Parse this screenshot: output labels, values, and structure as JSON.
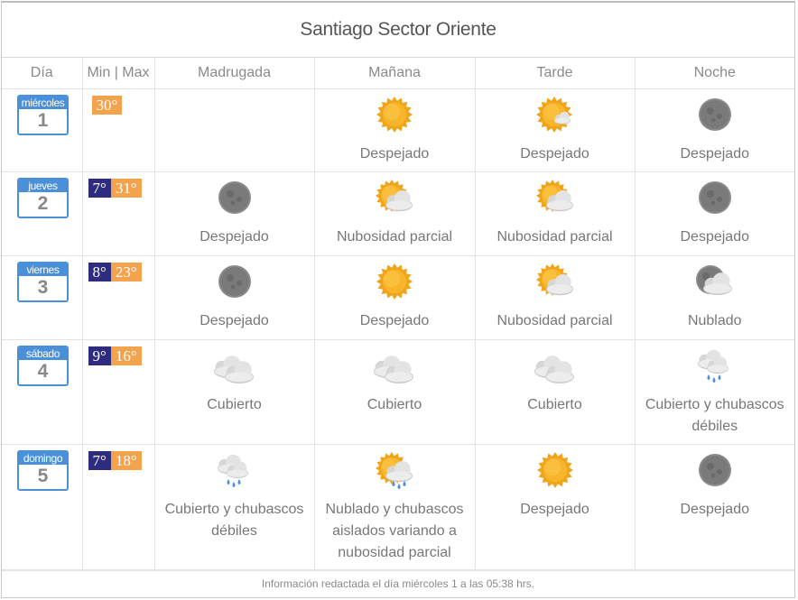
{
  "title": "Santiago Sector Oriente",
  "headers": {
    "dia": "Día",
    "minmax": "Min | Max",
    "madrugada": "Madrugada",
    "manana": "Mañana",
    "tarde": "Tarde",
    "noche": "Noche"
  },
  "colors": {
    "calendar_accent": "#4a90d9",
    "min_badge": "#2e2c7e",
    "max_badge": "#f4a34d"
  },
  "days": [
    {
      "name": "miércoles",
      "num": "1",
      "min": "",
      "max": "30°",
      "madrugada": {
        "icon": "",
        "text": ""
      },
      "manana": {
        "icon": "sun-icon",
        "text": "Despejado"
      },
      "tarde": {
        "icon": "sun-cloud-icon",
        "text": "Despejado"
      },
      "noche": {
        "icon": "moon-icon",
        "text": "Despejado"
      }
    },
    {
      "name": "jueves",
      "num": "2",
      "min": "7°",
      "max": "31°",
      "madrugada": {
        "icon": "moon-icon",
        "text": "Despejado"
      },
      "manana": {
        "icon": "partly-cloudy-icon",
        "text": "Nubosidad parcial"
      },
      "tarde": {
        "icon": "partly-cloudy-icon",
        "text": "Nubosidad parcial"
      },
      "noche": {
        "icon": "moon-icon",
        "text": "Despejado"
      }
    },
    {
      "name": "viernes",
      "num": "3",
      "min": "8°",
      "max": "23°",
      "madrugada": {
        "icon": "moon-icon",
        "text": "Despejado"
      },
      "manana": {
        "icon": "sun-icon",
        "text": "Despejado"
      },
      "tarde": {
        "icon": "partly-cloudy-icon",
        "text": "Nubosidad parcial"
      },
      "noche": {
        "icon": "moon-cloud-icon",
        "text": "Nublado"
      }
    },
    {
      "name": "sábado",
      "num": "4",
      "min": "9°",
      "max": "16°",
      "madrugada": {
        "icon": "cloud-icon",
        "text": "Cubierto"
      },
      "manana": {
        "icon": "cloud-icon",
        "text": "Cubierto"
      },
      "tarde": {
        "icon": "cloud-icon",
        "text": "Cubierto"
      },
      "noche": {
        "icon": "rain-cloud-icon",
        "text": "Cubierto y chubascos débiles"
      }
    },
    {
      "name": "domingo",
      "num": "5",
      "min": "7°",
      "max": "18°",
      "madrugada": {
        "icon": "rain-cloud-icon",
        "text": "Cubierto y chubascos débiles"
      },
      "manana": {
        "icon": "sun-rain-icon",
        "text": "Nublado y chubascos aislados variando a nubosidad parcial"
      },
      "tarde": {
        "icon": "sun-icon",
        "text": "Despejado"
      },
      "noche": {
        "icon": "moon-icon",
        "text": "Despejado"
      }
    }
  ],
  "footer": "Información redactada el día miércoles 1 a las 05:38 hrs."
}
